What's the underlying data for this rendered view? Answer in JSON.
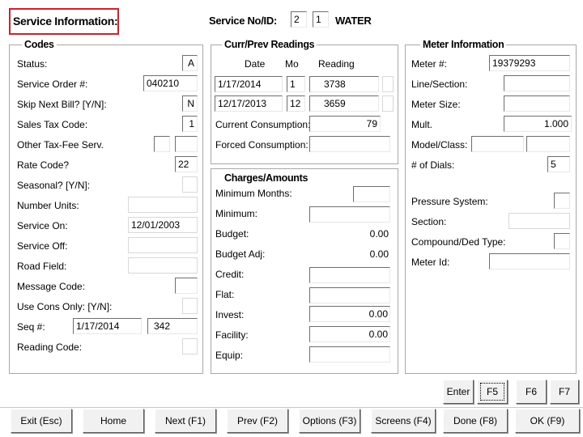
{
  "header": {
    "title": "Service Information:",
    "service_label": "Service No/ID:",
    "service_no": "2",
    "service_id": "1",
    "service_type": "WATER",
    "highlight_color": "#d0202a"
  },
  "codes": {
    "title": "Codes",
    "status_label": "Status:",
    "status_value": "A",
    "service_order_label": "Service Order #:",
    "service_order_value": "040210",
    "skip_next_bill_label": "Skip Next Bill? [Y/N]:",
    "skip_next_bill_value": "N",
    "sales_tax_label": "Sales Tax Code:",
    "sales_tax_value": "1",
    "other_tax_label": "Other Tax-Fee Serv.",
    "rate_code_label": "Rate Code?",
    "rate_code_value": "22",
    "seasonal_label": "Seasonal? [Y/N]:",
    "number_units_label": "Number Units:",
    "service_on_label": "Service On:",
    "service_on_value": "12/01/2003",
    "service_off_label": "Service Off:",
    "road_field_label": "Road Field:",
    "message_code_label": "Message Code:",
    "use_cons_only_label": "Use Cons Only: [Y/N]:",
    "seq_label": "Seq #:",
    "seq_date": "1/17/2014",
    "seq_value": "342",
    "reading_code_label": "Reading Code:"
  },
  "readings": {
    "title": "Curr/Prev Readings",
    "col_date": "Date",
    "col_mo": "Mo",
    "col_reading": "Reading",
    "curr_date": "1/17/2014",
    "curr_mo": "1",
    "curr_reading": "3738",
    "prev_date": "12/17/2013",
    "prev_mo": "12",
    "prev_reading": "3659",
    "current_consumption_label": "Current Consumption:",
    "current_consumption_value": "79",
    "forced_consumption_label": "Forced Consumption:"
  },
  "charges": {
    "title": "Charges/Amounts",
    "minimum_months_label": "Minimum Months:",
    "minimum_label": "Minimum:",
    "budget_label": "Budget:",
    "budget_value": "0.00",
    "budget_adj_label": "Budget Adj:",
    "budget_adj_value": "0.00",
    "credit_label": "Credit:",
    "flat_label": "Flat:",
    "invest_label": "Invest:",
    "invest_value": "0.00",
    "facility_label": "Facility:",
    "facility_value": "0.00",
    "equip_label": "Equip:"
  },
  "meter": {
    "title": "Meter Information",
    "meter_no_label": "Meter #:",
    "meter_no_value": "19379293",
    "line_section_label": "Line/Section:",
    "meter_size_label": "Meter Size:",
    "mult_label": "Mult.",
    "mult_value": "1.000",
    "model_class_label": "Model/Class:",
    "dials_label": "# of Dials:",
    "dials_value": "5",
    "pressure_system_label": "Pressure System:",
    "section_label": "Section:",
    "compound_label": "Compound/Ded Type:",
    "meter_id_label": "Meter Id:"
  },
  "fkeys": {
    "enter": "Enter",
    "f5": "F5",
    "f6": "F6",
    "f7": "F7"
  },
  "buttons": {
    "exit": "Exit (Esc)",
    "home": "Home",
    "next": "Next (F1)",
    "prev": "Prev (F2)",
    "options": "Options (F3)",
    "screens": "Screens (F4)",
    "done": "Done (F8)",
    "ok": "OK (F9)"
  }
}
